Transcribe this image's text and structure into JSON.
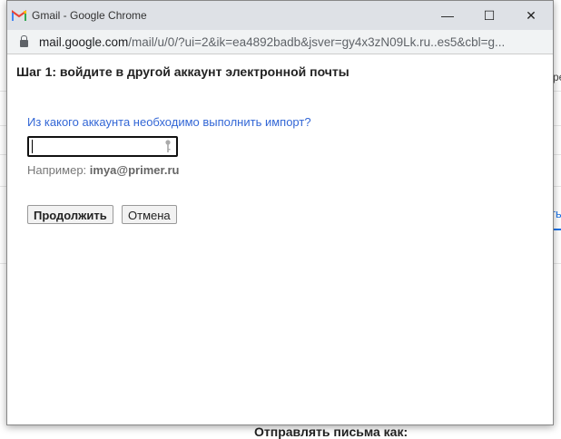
{
  "window": {
    "title": "Gmail - Google Chrome",
    "minimize": "—",
    "maximize": "☐",
    "close": "✕"
  },
  "address": {
    "host": "mail.google.com",
    "path": "/mail/u/0/?ui=2&ik=ea4892badb&jsver=gy4x3zN09Lk.ru..es5&cbl=g..."
  },
  "dialog": {
    "heading": "Шаг 1: войдите в другой аккаунт электронной почты",
    "question": "Из какого аккаунта необходимо выполнить импорт?",
    "input_value": "",
    "example_label": "Например: ",
    "example_value": "imya@primer.ru",
    "continue_label": "Продолжить",
    "cancel_label": "Отмена"
  },
  "background": {
    "right_text": "ре",
    "right_link": "ть",
    "bottom_text": "Отправлять письма как:"
  }
}
